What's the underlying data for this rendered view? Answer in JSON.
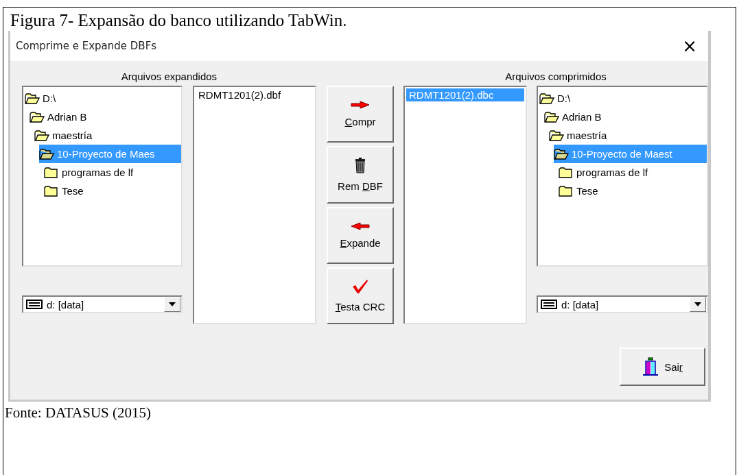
{
  "caption": "Figura 7- Expansão do banco utilizando TabWin.",
  "window": {
    "title": "Comprime e Expande DBFs",
    "close": "×"
  },
  "expanded_panel": {
    "label": "Arquivos expandidos",
    "tree": [
      {
        "name": "D:\\",
        "expanded": true,
        "selected": false,
        "children": [
          {
            "name": "Adrian B",
            "expanded": true,
            "selected": false,
            "children": [
              {
                "name": "maestría",
                "expanded": true,
                "selected": false,
                "children": [
                  {
                    "name": "10-Proyecto de Maes",
                    "expanded": true,
                    "selected": true,
                    "children": [
                      {
                        "name": "programas de lf",
                        "expanded": false,
                        "selected": false
                      },
                      {
                        "name": "Tese",
                        "expanded": false,
                        "selected": false
                      }
                    ]
                  }
                ]
              }
            ]
          }
        ]
      }
    ],
    "drive": "d: [data]",
    "files": [
      {
        "name": "RDMT1201(2).dbf",
        "selected": false
      }
    ]
  },
  "buttons": [
    {
      "kind": "compress",
      "key": "C",
      "post": "ompr"
    },
    {
      "kind": "remove",
      "pre": "Rem ",
      "key": "D",
      "post": "BF"
    },
    {
      "kind": "expand",
      "key": "E",
      "post": "xpande"
    },
    {
      "kind": "check",
      "key": "T",
      "post": "esta CRC"
    }
  ],
  "compressed_panel": {
    "label": "Arquivos comprimidos",
    "files": [
      {
        "name": "RDMT1201(2).dbc",
        "selected": true
      }
    ],
    "tree": [
      {
        "name": "D:\\",
        "expanded": true,
        "selected": false,
        "children": [
          {
            "name": "Adrian B",
            "expanded": true,
            "selected": false,
            "children": [
              {
                "name": "maestría",
                "expanded": true,
                "selected": false,
                "children": [
                  {
                    "name": "10-Proyecto de Maest",
                    "expanded": true,
                    "selected": true,
                    "children": [
                      {
                        "name": "programas de lf",
                        "expanded": false,
                        "selected": false
                      },
                      {
                        "name": "Tese",
                        "expanded": false,
                        "selected": false
                      }
                    ]
                  }
                ]
              }
            ]
          }
        ]
      }
    ],
    "drive": "d: [data]"
  },
  "exit_button": {
    "pre": "Sai",
    "key": "r"
  },
  "source": "Fonte: DATASUS (2015)"
}
